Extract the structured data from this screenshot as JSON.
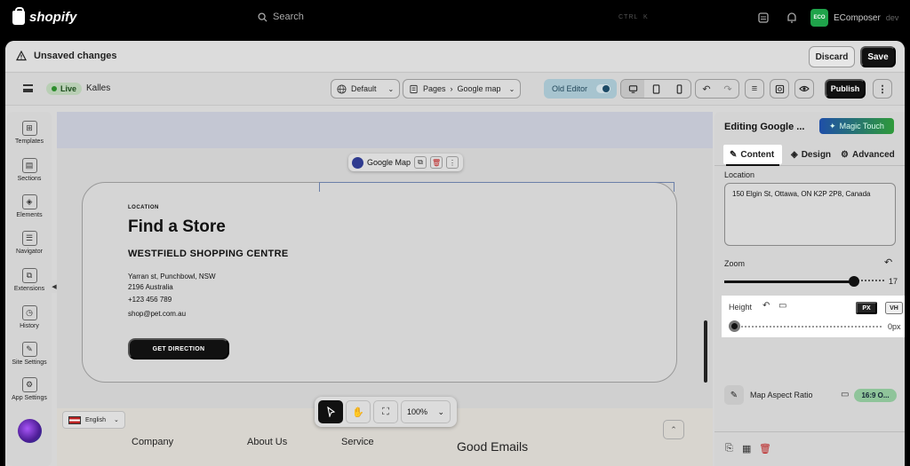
{
  "topbar": {
    "brand": "shopify",
    "search_placeholder": "Search",
    "shortcut_mod": "CTRL",
    "shortcut_key": "K",
    "store_badge": "EComposer",
    "store_badge_short": "ECO",
    "store_name": "EComposer",
    "store_sub": "dev"
  },
  "unsaved": {
    "message": "Unsaved changes",
    "discard": "Discard",
    "save": "Save"
  },
  "toolbar": {
    "live": "Live",
    "theme_name": "Kalles",
    "theme_select": "Default",
    "pages_label": "Pages",
    "page_name": "Google map",
    "old_editor": "Old Editor",
    "publish": "Publish"
  },
  "left_sidebar": [
    {
      "label": "Templates",
      "icon": "templates-icon",
      "glyph": "⊞"
    },
    {
      "label": "Sections",
      "icon": "sections-icon",
      "glyph": "▤"
    },
    {
      "label": "Elements",
      "icon": "elements-icon",
      "glyph": "◈"
    },
    {
      "label": "Navigator",
      "icon": "navigator-icon",
      "glyph": "☰"
    },
    {
      "label": "Extensions",
      "icon": "extensions-icon",
      "glyph": "⧉"
    },
    {
      "label": "History",
      "icon": "history-icon",
      "glyph": "◷"
    },
    {
      "label": "Site Settings",
      "icon": "site-settings-icon",
      "glyph": "✎"
    },
    {
      "label": "App Settings",
      "icon": "app-settings-icon",
      "glyph": "⚙"
    }
  ],
  "canvas": {
    "element_chip": "Google Map",
    "location_label": "LOCATION",
    "title": "Find a Store",
    "centre": "WESTFIELD SHOPPING CENTRE",
    "address_line1": "Yarran st, Punchbowl, NSW",
    "address_line2": "2196 Australia",
    "phone": "+123 456 789",
    "email": "shop@pet.com.au",
    "cta": "GET DIRECTION",
    "language": "English",
    "footer_links": [
      "Company",
      "About Us",
      "Service"
    ],
    "footer_heading": "Good Emails",
    "zoom_level": "100%"
  },
  "right_panel": {
    "title": "Editing Google ...",
    "magic": "Magic Touch",
    "tabs": [
      "Content",
      "Design",
      "Advanced"
    ],
    "location_label": "Location",
    "location_value": "150 Elgin St, Ottawa, ON K2P 2P8, Canada",
    "zoom_label": "Zoom",
    "zoom_value": "17",
    "zoom_level": 17,
    "height_label": "Height",
    "unit_px": "PX",
    "unit_vh": "VH",
    "height_value": "0px",
    "height_level": 0,
    "aspect_label": "Map Aspect Ratio",
    "aspect_value": "16:9 O..."
  },
  "colors": {
    "accent_green": "#1fa34a",
    "live_green": "#2d8d2d",
    "publish_black": "#111111"
  }
}
